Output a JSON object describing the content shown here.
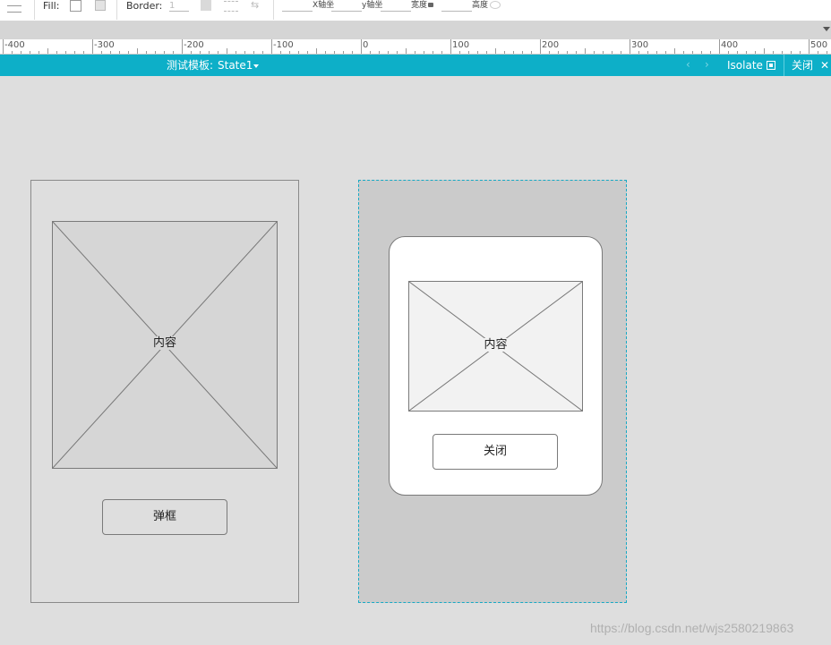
{
  "toolbar": {
    "fill_label": "Fill:",
    "border_label": "Border:",
    "border_value": "1",
    "x_label": "X轴坐",
    "y_label": "y轴坐",
    "w_label": "宽度",
    "h_label": "高度"
  },
  "ruler": {
    "labels": [
      "-400",
      "-300",
      "-200",
      "-100",
      "0",
      "100",
      "200",
      "300",
      "400",
      "500"
    ]
  },
  "header": {
    "title": "测试模板:",
    "state": "State1",
    "isolate_label": "Isolate",
    "close_label": "关闭",
    "prev_icon": "chevron-left-icon",
    "next_icon": "chevron-right-icon",
    "close_icon": "close-icon"
  },
  "canvas": {
    "left_screen": {
      "image_label": "内容",
      "button_label": "弹框"
    },
    "dialog_state": {
      "image_label": "内容",
      "button_label": "关闭"
    }
  },
  "watermark": "https://blog.csdn.net/wjs2580219863",
  "colors": {
    "accent": "#0dafc8",
    "canvas_bg": "#dedede",
    "dynamic_panel_bg": "#cbcbcb",
    "panel_border": "#17a9c4"
  }
}
